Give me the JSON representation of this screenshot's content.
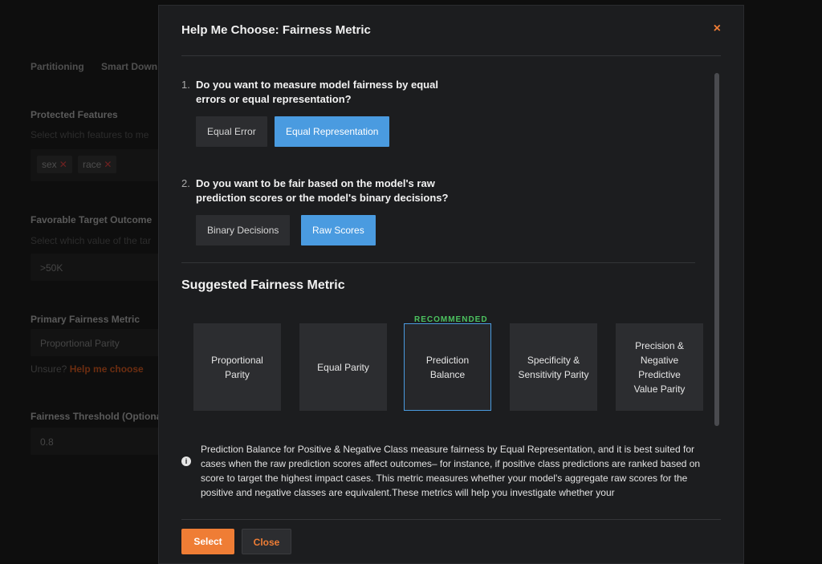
{
  "background": {
    "tabs": [
      "Partitioning",
      "Smart Down"
    ],
    "protected_features": {
      "label": "Protected Features",
      "hint": "Select which features to me",
      "tags": [
        "sex",
        "race"
      ]
    },
    "favorable_outcome": {
      "label": "Favorable Target Outcome",
      "hint": "Select which value of the tar",
      "value": ">50K"
    },
    "primary_metric": {
      "label": "Primary Fairness Metric",
      "value": "Proportional Parity",
      "unsure": "Unsure?",
      "help_link": "Help me choose"
    },
    "threshold": {
      "label": "Fairness Threshold (Optiona",
      "value": "0.8"
    }
  },
  "modal": {
    "title": "Help Me Choose: Fairness Metric",
    "close_icon": "×",
    "q1": {
      "number": "1.",
      "text": "Do you want to measure model fairness by equal errors or equal representation?",
      "options": [
        "Equal Error",
        "Equal Representation"
      ],
      "selected": "Equal Representation"
    },
    "q2": {
      "number": "2.",
      "text": "Do you want to be fair based on the model's raw prediction scores or the model's binary decisions?",
      "options": [
        "Binary Decisions",
        "Raw Scores"
      ],
      "selected": "Raw Scores"
    },
    "suggested_title": "Suggested Fairness Metric",
    "recommended_label": "RECOMMENDED",
    "cards": [
      "Proportional Parity",
      "Equal Parity",
      "Prediction Balance",
      "Specificity & Sensitivity Parity",
      "Precision & Negative Predictive Value Parity"
    ],
    "selected_card": "Prediction Balance",
    "description": "Prediction Balance for Positive & Negative Class measure fairness by Equal Representation, and it is best suited for cases when the raw prediction scores affect outcomes– for instance, if positive class predictions are ranked based on score to target the highest impact cases. This metric measures whether your model's aggregate raw scores for the positive and negative classes are equivalent.These metrics will help you investigate whether your",
    "select_button": "Select",
    "close_button": "Close"
  },
  "colors": {
    "accent": "#ef7d35",
    "selected_blue": "#4a9be0",
    "recommended_green": "#4cc25f"
  }
}
